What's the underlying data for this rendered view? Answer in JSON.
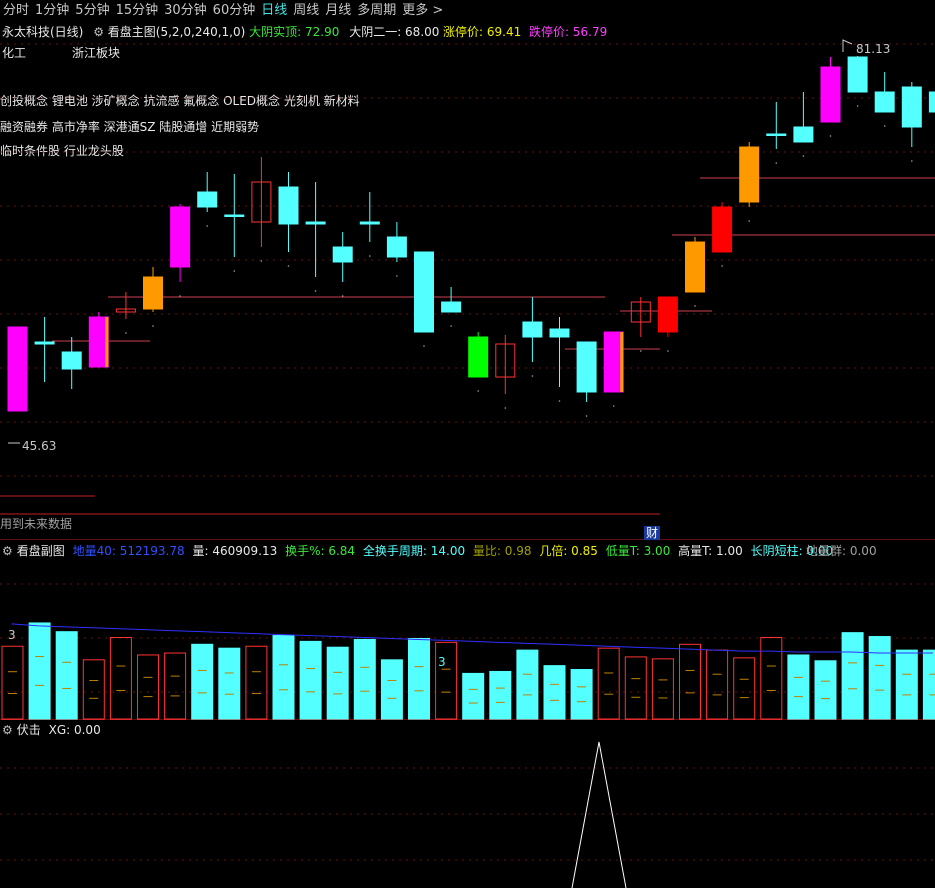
{
  "tabs": [
    "分时",
    "1分钟",
    "5分钟",
    "15分钟",
    "30分钟",
    "60分钟",
    "日线",
    "周线",
    "月线",
    "多周期",
    "更多 >"
  ],
  "active_tab": "日线",
  "main_header": {
    "stock": "永太科技(日线)",
    "gear": "⚙",
    "indicator": "看盘主图(5,2,0,240,1,0)",
    "dayin_label": "大阴实顶: 72.90",
    "dayin2_label": "大阴二一: 68.00",
    "limit_up_label": "涨停价: 69.41",
    "limit_down_label": "跌停价: 56.79"
  },
  "sector_left": "化工",
  "sector_right": "浙江板块",
  "concept_lines": [
    "创投概念 锂电池 涉矿概念 抗流感 氟概念 OLED概念 光刻机 新材料",
    "融资融券 高市净率 深港通SZ 陆股通增 近期弱势",
    "临时条件股 行业龙头股"
  ],
  "price_high_label": "81.13",
  "price_low_label": "45.63",
  "future_data_label": "用到未来数据",
  "cai_label": "财",
  "sub_header": {
    "gear": "⚙",
    "name": "看盘副图",
    "ma_label": "地量40: 512193.78",
    "vol_label": "量: 460909.13",
    "turnover_label": "换手%: 6.84",
    "full_turnover_label": "全换手周期: 14.00",
    "ratio_label": "量比: 0.98",
    "times_label": "几倍: 0.85",
    "low_t_label": "低量T: 3.00",
    "high_t_label": "高量T: 1.00",
    "long_shadow_label": "长阴短柱: 0.00",
    "ground_label": "地量群: 0.00",
    "marker_3a": "3",
    "marker_3b": "3"
  },
  "ind_header": {
    "gear": "⚙",
    "name": "伏击",
    "xg_label": "XG: 0.00"
  },
  "colors": {
    "up": "#ff3232",
    "down": "#54ffff",
    "magenta": "#ff00ff",
    "orange": "#ff9900",
    "red_fill": "#ff0000",
    "green": "#00ff00",
    "pink_line": "#d04050",
    "blue": "#3030ff"
  },
  "chart_data": {
    "type": "candlestick",
    "ylim": [
      40.5,
      82.5
    ],
    "candles": [
      {
        "o": 54.0,
        "h": 54.0,
        "l": 45.6,
        "c": 45.6,
        "color": "magenta"
      },
      {
        "o": 52.5,
        "h": 55.0,
        "l": 48.5,
        "c": 52.3,
        "color": "cyan"
      },
      {
        "o": 51.5,
        "h": 53.0,
        "l": 47.8,
        "c": 49.8,
        "color": "cyan"
      },
      {
        "o": 55.0,
        "h": 55.5,
        "l": 50.0,
        "c": 50.0,
        "color": "magenta_orange"
      },
      {
        "o": 55.5,
        "h": 57.5,
        "l": 54.8,
        "c": 55.8,
        "color": "red_hollow"
      },
      {
        "o": 55.8,
        "h": 60.0,
        "l": 55.5,
        "c": 59.0,
        "color": "orange"
      },
      {
        "o": 60.0,
        "h": 66.3,
        "l": 58.5,
        "c": 66.0,
        "color": "magenta"
      },
      {
        "o": 67.5,
        "h": 69.5,
        "l": 65.5,
        "c": 66.0,
        "color": "cyan"
      },
      {
        "o": 65.2,
        "h": 69.3,
        "l": 61.0,
        "c": 65.2,
        "color": "cyan_doji"
      },
      {
        "o": 64.5,
        "h": 71.0,
        "l": 62.0,
        "c": 68.5,
        "color": "red_hollow"
      },
      {
        "o": 68.0,
        "h": 69.5,
        "l": 61.5,
        "c": 64.3,
        "color": "cyan"
      },
      {
        "o": 64.5,
        "h": 68.5,
        "l": 59.0,
        "c": 64.3,
        "color": "cyan_doji"
      },
      {
        "o": 62.0,
        "h": 63.5,
        "l": 58.5,
        "c": 60.5,
        "color": "cyan"
      },
      {
        "o": 64.5,
        "h": 67.5,
        "l": 62.5,
        "c": 64.3,
        "color": "cyan_doji"
      },
      {
        "o": 63.0,
        "h": 64.5,
        "l": 60.5,
        "c": 61.0,
        "color": "cyan"
      },
      {
        "o": 61.5,
        "h": 61.5,
        "l": 53.5,
        "c": 53.5,
        "color": "cyan"
      },
      {
        "o": 56.5,
        "h": 58.0,
        "l": 55.5,
        "c": 55.5,
        "color": "cyan"
      },
      {
        "o": 53.0,
        "h": 53.5,
        "l": 49.0,
        "c": 49.0,
        "color": "green"
      },
      {
        "o": 49.0,
        "h": 53.2,
        "l": 47.3,
        "c": 52.3,
        "color": "red_hollow"
      },
      {
        "o": 54.5,
        "h": 57.0,
        "l": 50.5,
        "c": 53.0,
        "color": "cyan"
      },
      {
        "o": 53.8,
        "h": 55.0,
        "l": 48.0,
        "c": 53.0,
        "color": "cyan"
      },
      {
        "o": 52.5,
        "h": 52.5,
        "l": 46.5,
        "c": 47.5,
        "color": "cyan"
      },
      {
        "o": 53.5,
        "h": 53.5,
        "l": 47.5,
        "c": 47.5,
        "color": "magenta_orange"
      },
      {
        "o": 54.5,
        "h": 57.0,
        "l": 53.0,
        "c": 56.5,
        "color": "red_hollow"
      },
      {
        "o": 53.5,
        "h": 57.0,
        "l": 53.0,
        "c": 57.0,
        "color": "red_fill"
      },
      {
        "o": 57.5,
        "h": 63.0,
        "l": 57.5,
        "c": 62.5,
        "color": "orange"
      },
      {
        "o": 61.5,
        "h": 66.5,
        "l": 61.5,
        "c": 66.0,
        "color": "red_fill"
      },
      {
        "o": 66.5,
        "h": 72.5,
        "l": 66.0,
        "c": 72.0,
        "color": "orange"
      },
      {
        "o": 73.3,
        "h": 76.5,
        "l": 71.8,
        "c": 73.3,
        "color": "cyan_doji"
      },
      {
        "o": 74.0,
        "h": 77.5,
        "l": 72.5,
        "c": 72.5,
        "color": "cyan"
      },
      {
        "o": 74.5,
        "h": 81.0,
        "l": 74.5,
        "c": 80.0,
        "color": "magenta"
      },
      {
        "o": 81.0,
        "h": 81.1,
        "l": 77.5,
        "c": 77.5,
        "color": "cyan"
      },
      {
        "o": 77.5,
        "h": 79.5,
        "l": 75.5,
        "c": 75.5,
        "color": "cyan"
      },
      {
        "o": 78.0,
        "h": 78.5,
        "l": 72.0,
        "c": 74.0,
        "color": "cyan"
      },
      {
        "o": 77.5,
        "h": 78.0,
        "l": 71.0,
        "c": 75.5,
        "color": "cyan"
      }
    ],
    "volume": {
      "ylim": [
        0,
        100
      ],
      "values": [
        75,
        99,
        90,
        61,
        84,
        66,
        68,
        77,
        73,
        75,
        86,
        80,
        74,
        82,
        61,
        83,
        79,
        47,
        49,
        71,
        55,
        51,
        73,
        64,
        62,
        77,
        71,
        63,
        84,
        66,
        60,
        89,
        85,
        71,
        71
      ],
      "colors": [
        "red",
        "cyan",
        "cyan",
        "red",
        "red",
        "red",
        "red",
        "cyan",
        "cyan",
        "red",
        "cyan",
        "cyan",
        "cyan",
        "cyan",
        "cyan",
        "cyan",
        "red",
        "cyan",
        "cyan",
        "cyan",
        "cyan",
        "cyan",
        "red",
        "red",
        "red",
        "red",
        "red",
        "red",
        "red",
        "cyan",
        "cyan",
        "cyan",
        "cyan",
        "cyan",
        "cyan"
      ],
      "ma": [
        98,
        96,
        95,
        94,
        93,
        92,
        91,
        90,
        89,
        88,
        87,
        86,
        85,
        84,
        83,
        82,
        81,
        80,
        79,
        78,
        77,
        76,
        75,
        74,
        73,
        72,
        71,
        70,
        70,
        69,
        69,
        69,
        68,
        68,
        68
      ]
    }
  }
}
